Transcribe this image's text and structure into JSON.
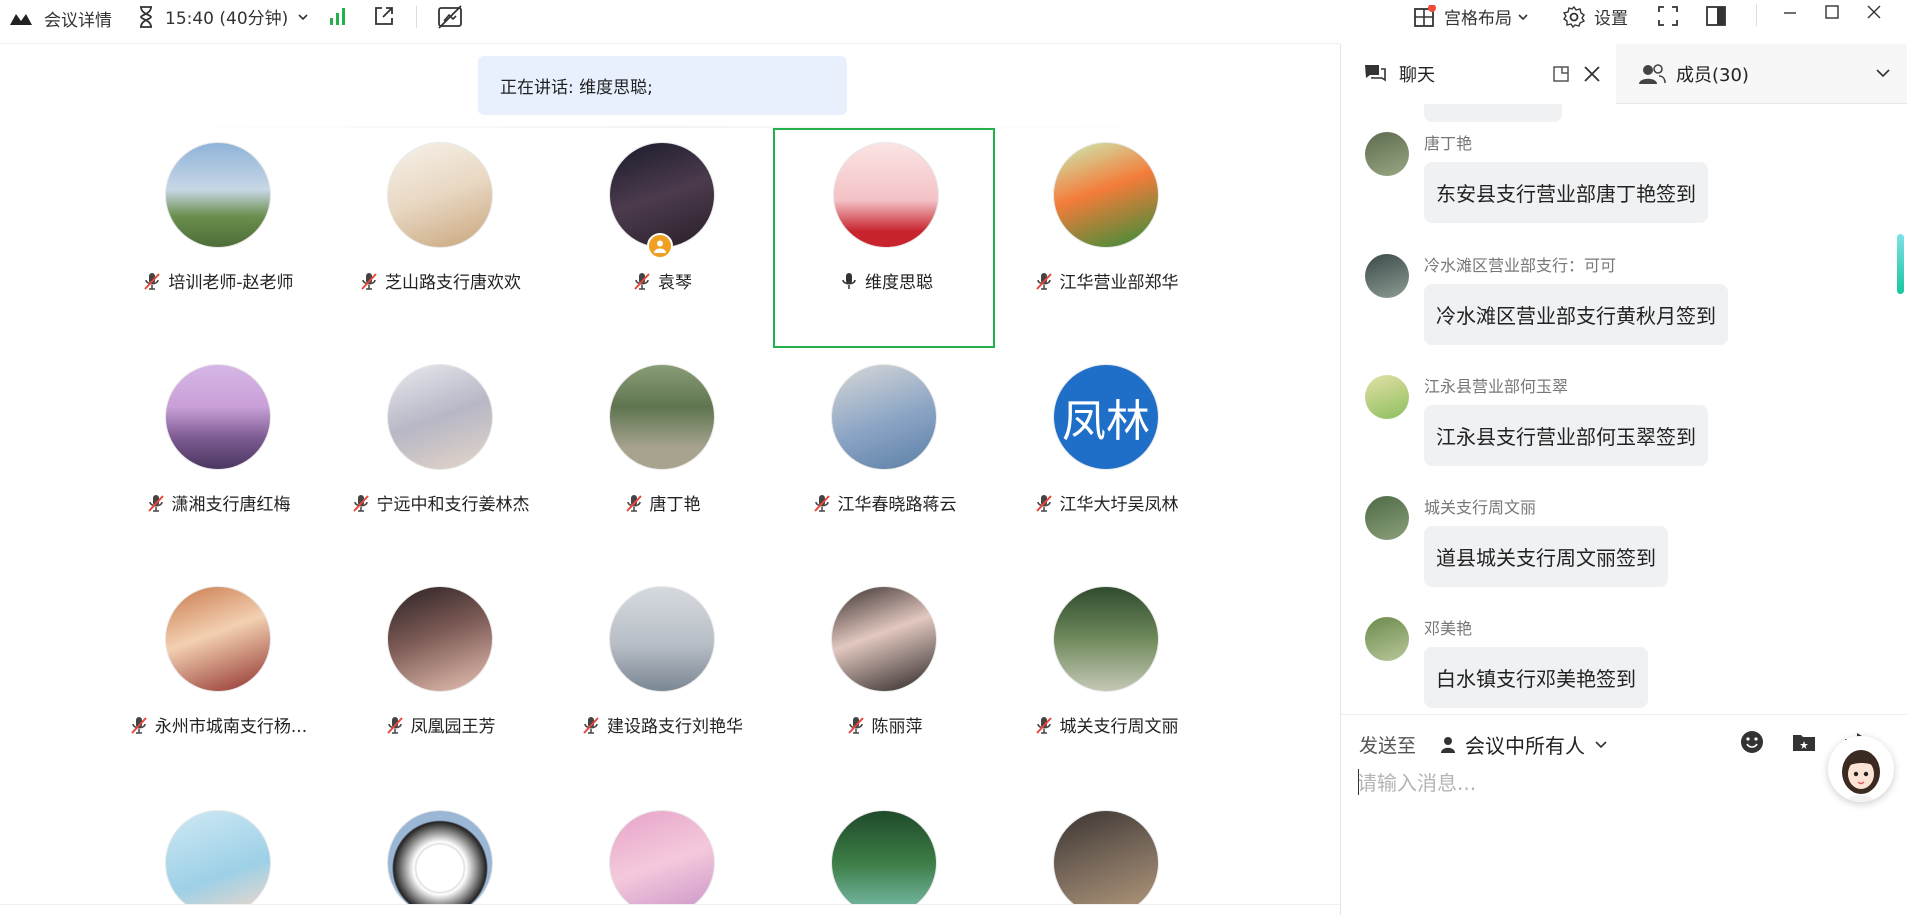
{
  "topbar": {
    "meeting_details": "会议详情",
    "timer": "15:40 (40分钟)",
    "layout": "宫格布局",
    "settings": "设置"
  },
  "speaking": "正在讲话: 维度思聪;",
  "participants": [
    {
      "name": "培训老师-赵老师",
      "muted": true
    },
    {
      "name": "芝山路支行唐欢欢",
      "muted": true
    },
    {
      "name": "袁琴",
      "muted": true,
      "host": true
    },
    {
      "name": "维度思聪",
      "muted": false,
      "active": true
    },
    {
      "name": "江华营业部郑华",
      "muted": true
    },
    {
      "name": "潇湘支行唐红梅",
      "muted": true
    },
    {
      "name": "宁远中和支行姜林杰",
      "muted": true
    },
    {
      "name": "唐丁艳",
      "muted": true
    },
    {
      "name": "江华春晓路蒋云",
      "muted": true
    },
    {
      "name": "江华大圩吴凤林",
      "muted": true,
      "avatar_text": "凤林"
    },
    {
      "name": "永州市城南支行杨...",
      "muted": true
    },
    {
      "name": "凤凰园王芳",
      "muted": true
    },
    {
      "name": "建设路支行刘艳华",
      "muted": true
    },
    {
      "name": "陈丽萍",
      "muted": true
    },
    {
      "name": "城关支行周文丽",
      "muted": true
    }
  ],
  "panel": {
    "tab_chat": "聊天",
    "tab_members": "成员(30)",
    "messages": [
      {
        "sender": "唐丁艳",
        "text": "东安县支行营业部唐丁艳签到"
      },
      {
        "sender": "冷水滩区营业部支行：可可",
        "text": "冷水滩区营业部支行黄秋月签到"
      },
      {
        "sender": "江永县营业部何玉翠",
        "text": "江永县支行营业部何玉翠签到"
      },
      {
        "sender": "城关支行周文丽",
        "text": "道县城关支行周文丽签到"
      },
      {
        "sender": "邓美艳",
        "text": "白水镇支行邓美艳签到"
      }
    ],
    "send_to_label": "发送至",
    "send_target": "会议中所有人",
    "input_placeholder": "请输入消息..."
  },
  "colors": {
    "accent": "#22b14c",
    "speaking_bg": "#e8f0fd",
    "bubble_bg": "#f0f1f3",
    "text_avatar": "#1f6fc9"
  }
}
